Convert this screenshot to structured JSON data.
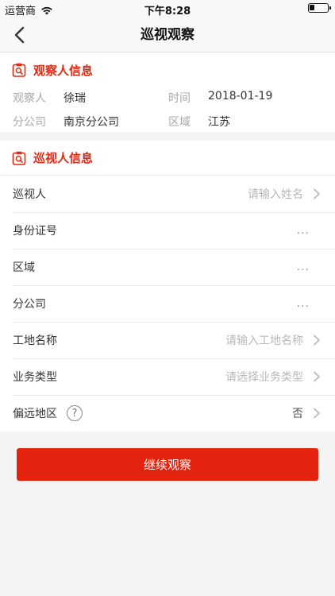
{
  "status_bar": {
    "carrier": "运营商",
    "time": "下午8:28"
  },
  "nav": {
    "title": "巡视观察"
  },
  "observer_section": {
    "title": "观察人信息",
    "observer_label": "观察人",
    "observer_value": "徐瑞",
    "time_label": "时间",
    "time_value": "2018-01-19",
    "branch_label": "分公司",
    "branch_value": "南京分公司",
    "region_label": "区域",
    "region_value": "江苏"
  },
  "patrol_section": {
    "title": "巡视人信息",
    "rows": [
      {
        "label": "巡视人",
        "placeholder": "请输入姓名"
      },
      {
        "label": "身份证号",
        "value": "..."
      },
      {
        "label": "区域",
        "value": "..."
      },
      {
        "label": "分公司",
        "value": "..."
      },
      {
        "label": "工地名称",
        "placeholder": "请输入工地名称"
      },
      {
        "label": "业务类型",
        "placeholder": "请选择业务类型"
      },
      {
        "label": "偏远地区",
        "help": "?",
        "value": "否"
      }
    ]
  },
  "submit": {
    "label": "继续观察"
  },
  "colors": {
    "accent": "#e3230e",
    "title_red": "#e02a14"
  },
  "icons": [
    "back-arrow-icon",
    "wifi-icon",
    "battery-icon",
    "clipboard-search-icon",
    "chevron-right-icon",
    "help-icon"
  ]
}
